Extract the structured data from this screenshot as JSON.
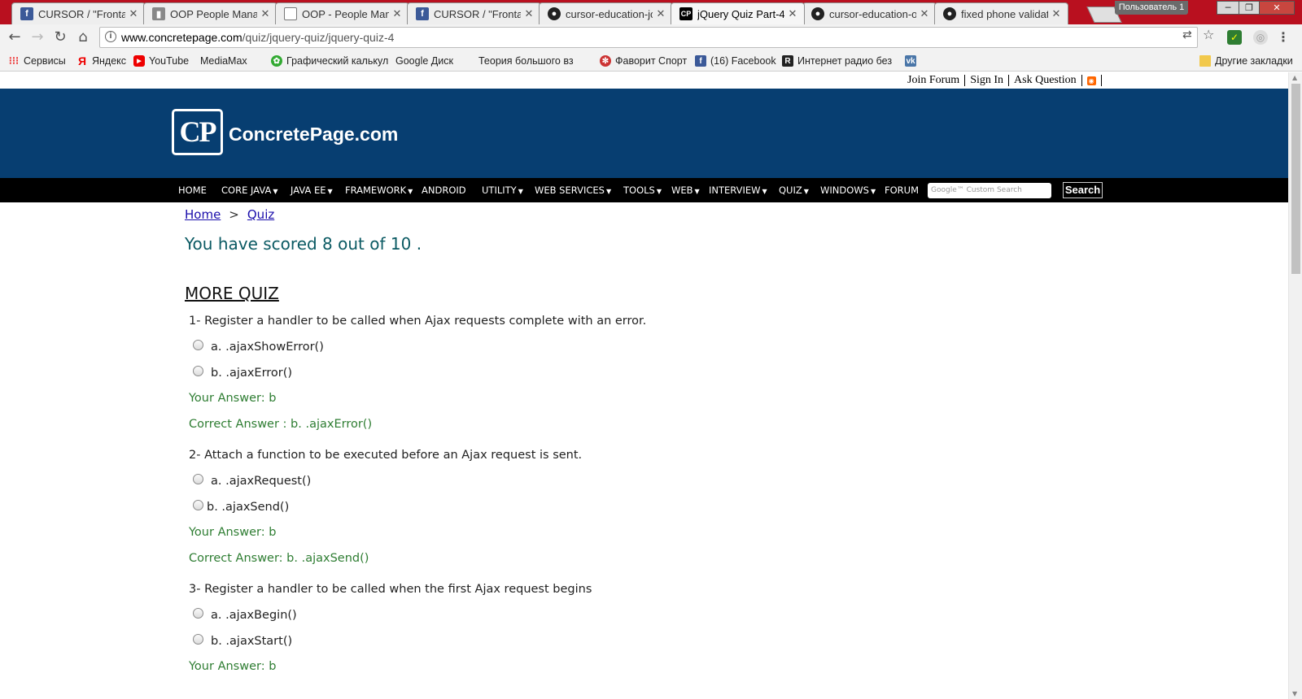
{
  "browser": {
    "tabs": [
      {
        "label": "CURSOR / \"Frontast",
        "icon": "facebook-icon"
      },
      {
        "label": "OOP People Manag",
        "icon": "trello-icon"
      },
      {
        "label": "OOP - People Mana",
        "icon": "document-icon"
      },
      {
        "label": "CURSOR / \"Frontast",
        "icon": "facebook-icon"
      },
      {
        "label": "cursor-education-jo",
        "icon": "github-icon"
      },
      {
        "label": "jQuery Quiz Part-4",
        "icon": "cp-icon",
        "active": true
      },
      {
        "label": "cursor-education-o",
        "icon": "github-icon"
      },
      {
        "label": "fixed phone validati",
        "icon": "github-icon"
      }
    ],
    "close_glyph": "✕",
    "profile_label": "Пользователь 1",
    "url_host": "www.concretepage.com",
    "url_path": "/quiz/jquery-quiz/jquery-quiz-4",
    "bookmarks": [
      {
        "label": "Сервисы",
        "icon": "apps-icon"
      },
      {
        "label": "Яндекс",
        "icon": "yandex-icon"
      },
      {
        "label": "YouTube",
        "icon": "youtube-icon"
      },
      {
        "label": "MediaMax",
        "icon": "page-icon"
      },
      {
        "label": "Графический калькул",
        "icon": "calculator-icon"
      },
      {
        "label": "Google Диск",
        "icon": "page-icon"
      },
      {
        "label": "Теория большого вз",
        "icon": "page-icon"
      },
      {
        "label": "Фаворит Спорт",
        "icon": "favorit-icon"
      },
      {
        "label": "(16) Facebook",
        "icon": "facebook-icon"
      },
      {
        "label": "Интернет радио без",
        "icon": "radio-icon"
      },
      {
        "label": "",
        "icon": "vk-icon"
      }
    ],
    "other_bookmarks": "Другие закладки"
  },
  "site": {
    "top_links": {
      "join": "Join Forum",
      "signin": "Sign In",
      "ask": "Ask Question"
    },
    "logo_mark": "CP",
    "logo_text": "ConcretePage.com",
    "menu": [
      {
        "label": "HOME",
        "caret": false
      },
      {
        "label": "CORE JAVA",
        "caret": true
      },
      {
        "label": "JAVA EE",
        "caret": true
      },
      {
        "label": "FRAMEWORK",
        "caret": true
      },
      {
        "label": "ANDROID",
        "caret": false
      },
      {
        "label": "UTILITY",
        "caret": true
      },
      {
        "label": "WEB SERVICES",
        "caret": true
      },
      {
        "label": "TOOLS",
        "caret": true
      },
      {
        "label": "WEB",
        "caret": true
      },
      {
        "label": "INTERVIEW",
        "caret": true
      },
      {
        "label": "QUIZ",
        "caret": true
      },
      {
        "label": "WINDOWS",
        "caret": true
      },
      {
        "label": "FORUM",
        "caret": false
      }
    ],
    "search_placeholder": "Google™ Custom Search",
    "search_button": "Search"
  },
  "content": {
    "breadcrumb": {
      "home": "Home",
      "sep": ">",
      "quiz": "Quiz"
    },
    "score": "You have scored 8 out of 10 .",
    "more_quiz": "MORE QUIZ",
    "questions": [
      {
        "text": "1- Register a handler to be called when Ajax requests complete with an error.",
        "options": [
          "a. .ajaxShowError()",
          "b. .ajaxError()"
        ],
        "your_answer": "Your Answer: b",
        "correct_answer": "Correct Answer : b. .ajaxError()"
      },
      {
        "text": "2- Attach a function to be executed before an Ajax request is sent.",
        "options": [
          "a. .ajaxRequest()",
          "b. .ajaxSend()"
        ],
        "your_answer": "Your Answer: b",
        "correct_answer": "Correct Answer: b. .ajaxSend()"
      },
      {
        "text": "3- Register a handler to be called when the first Ajax request begins",
        "options": [
          "a. .ajaxBegin()",
          "b. .ajaxStart()"
        ],
        "your_answer": "Your Answer: b"
      }
    ]
  }
}
